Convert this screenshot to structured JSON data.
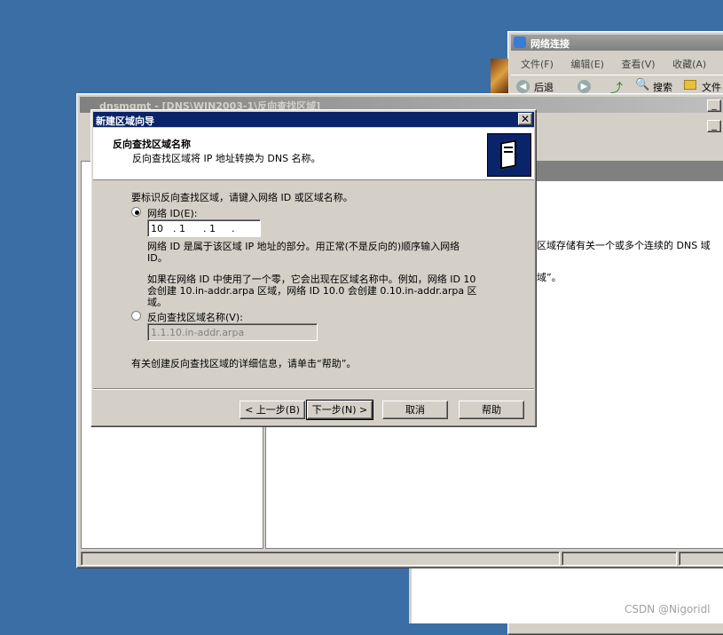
{
  "net_window": {
    "title": "网络连接",
    "menu": [
      "文件(F)",
      "编辑(E)",
      "查看(V)",
      "收藏(A)"
    ],
    "toolbar": {
      "back": "后退",
      "search": "搜索",
      "folders": "文件"
    },
    "body_text_1": "区域存储有关一个或多个连续的 DNS 域",
    "body_text_2": "域”。"
  },
  "dnsmgmt": {
    "title": "dnsmgmt - [DNS\\WIN2003-1\\反向查找区域]"
  },
  "wizard": {
    "title": "新建区域向导",
    "header_title": "反向查找区域名称",
    "header_subtitle": "反向查找区域将 IP 地址转换为 DNS 名称。",
    "intro": "要标识反向查找区域，请键入网络 ID 或区域名称。",
    "radio_network_id": "网络 ID(E):",
    "ip_octets": [
      "10",
      "1",
      "1",
      ""
    ],
    "desc_1": "网络 ID 是属于该区域 IP 地址的部分。用正常(不是反向的)顺序输入网络 ID。",
    "desc_2": "如果在网络 ID 中使用了一个零，它会出现在区域名称中。例如，网络 ID 10 会创建 10.in-addr.arpa 区域，网络 ID 10.0 会创建 0.10.in-addr.arpa 区域。",
    "radio_zone_name": "反向查找区域名称(V):",
    "zone_name_value": "1.1.10.in-addr.arpa",
    "help_hint": "有关创建反向查找区域的详细信息，请单击“帮助”。",
    "buttons": {
      "back": "< 上一步(B)",
      "next": "下一步(N) >",
      "cancel": "取消",
      "help": "帮助"
    }
  },
  "watermark": "CSDN @Nigoridl"
}
